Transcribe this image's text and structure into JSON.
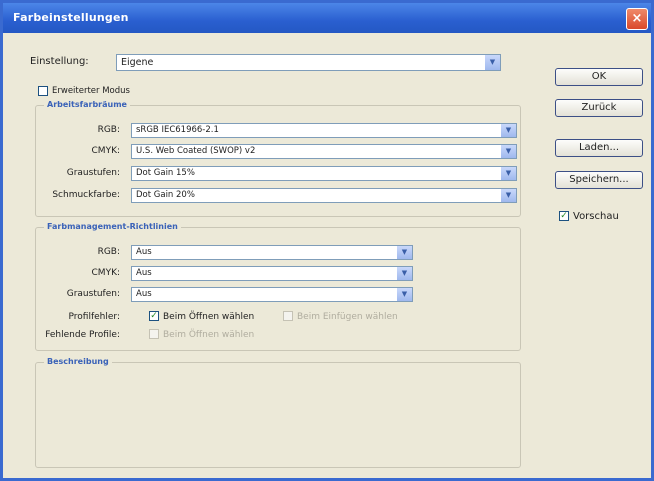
{
  "window": {
    "title": "Farbeinstellungen",
    "close_glyph": "×"
  },
  "settings": {
    "label": "Einstellung:",
    "value": "Eigene"
  },
  "advanced_mode": {
    "label": "Erweiterter Modus",
    "checked": false
  },
  "working_spaces": {
    "title": "Arbeitsfarbräume",
    "rows": [
      {
        "label": "RGB:",
        "value": "sRGB IEC61966-2.1"
      },
      {
        "label": "CMYK:",
        "value": "U.S. Web Coated (SWOP) v2"
      },
      {
        "label": "Graustufen:",
        "value": "Dot Gain 15%"
      },
      {
        "label": "Schmuckfarbe:",
        "value": "Dot Gain 20%"
      }
    ]
  },
  "color_management": {
    "title": "Farbmanagement-Richtlinien",
    "rows": [
      {
        "label": "RGB:",
        "value": "Aus"
      },
      {
        "label": "CMYK:",
        "value": "Aus"
      },
      {
        "label": "Graustufen:",
        "value": "Aus"
      }
    ],
    "profile_mismatch": {
      "label": "Profilfehler:",
      "option1": "Beim Öffnen wählen",
      "option2": "Beim Einfügen wählen"
    },
    "missing_profiles": {
      "label": "Fehlende Profile:",
      "option1": "Beim Öffnen wählen"
    }
  },
  "description": {
    "title": "Beschreibung"
  },
  "buttons": {
    "ok": "OK",
    "cancel": "Zurück",
    "load": "Laden...",
    "save": "Speichern..."
  },
  "preview": {
    "label": "Vorschau",
    "checked": true
  },
  "icons": {
    "dropdown_arrow": "▼",
    "check": "✓"
  }
}
